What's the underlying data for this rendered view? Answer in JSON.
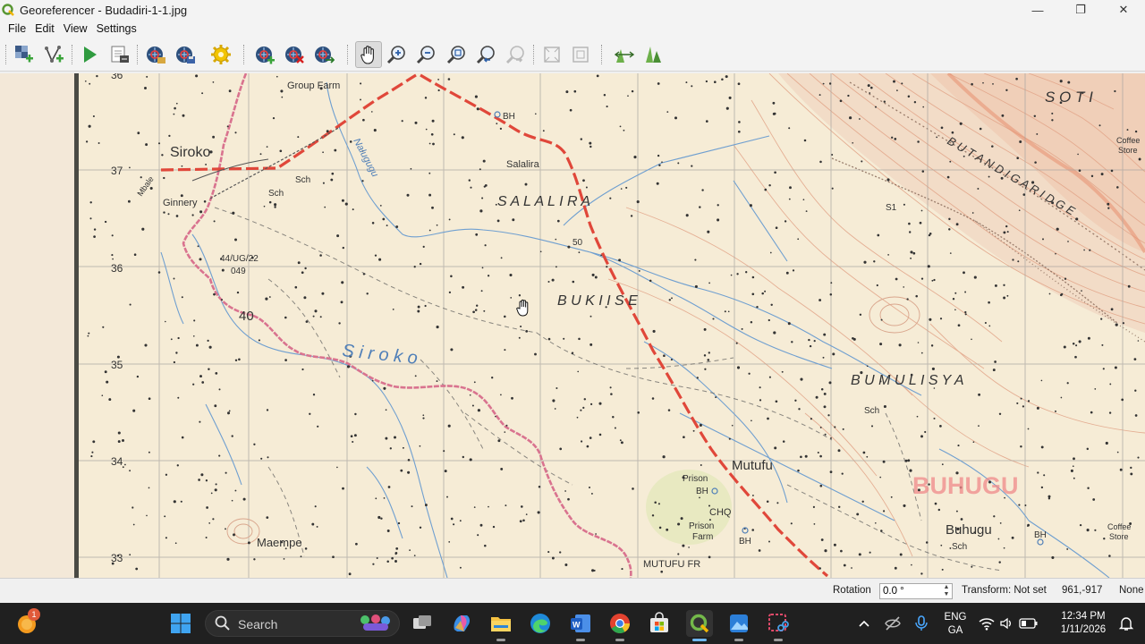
{
  "window": {
    "title": "Georeferencer - Budadiri-1-1.jpg",
    "controls": [
      "—",
      "❐",
      "✕"
    ]
  },
  "menu": [
    "File",
    "Edit",
    "View",
    "Settings"
  ],
  "toolbar": {
    "icons": [
      "add-raster-icon",
      "add-vector-icon",
      "start-georeferencing-icon",
      "generate-gdal-script-icon",
      "load-gcp-points-icon",
      "save-gcp-points-icon",
      "transformation-settings-icon",
      "add-point-icon",
      "delete-point-icon",
      "move-gcp-point-icon",
      "pan-icon",
      "zoom-in-icon",
      "zoom-out-icon",
      "zoom-to-layer-icon",
      "zoom-last-icon",
      "zoom-next-icon",
      "link-georeferencer-to-qgis-icon",
      "link-qgis-to-georeferencer-icon",
      "full-histogram-stretch-icon",
      "local-histogram-stretch-icon"
    ]
  },
  "map": {
    "grid_labels": [
      "36",
      "37",
      "36",
      "35",
      "34",
      "33"
    ],
    "places": {
      "group_farm": "Group Farm",
      "siroko": "Siroko",
      "ginnery": "Ginnery",
      "sch1": "Sch",
      "sch2": "Sch",
      "nalugugu": "Nalugugu",
      "bh1": "BH",
      "salalira": "Salalira",
      "salalira_area": "S A L A L I R A",
      "val50": "50",
      "trig": "44/UG/22",
      "trig2": "049",
      "val40": "40",
      "bukiise": "B U K I I S E",
      "siroko_river": "S i r o k o",
      "soti": "S O T I",
      "coffee_store1": "Coffee",
      "coffee_store1b": "Store",
      "butandiga": "B U T A N D I G A   R I D G E",
      "s1": "S1",
      "bumulisya": "B U M U L I S Y A",
      "sch3": "Sch",
      "buhugu_big": "BUHUGU",
      "mutufu": "Mutufu",
      "prison": "Prison",
      "bh2": "BH",
      "chq": "CHQ",
      "prison_farm1": "Prison",
      "prison_farm2": "Farm",
      "bh3": "BH",
      "mutufu_fr": "MUTUFU   FR",
      "maempe": "Maempe",
      "buhugu": "Buhugu",
      "sch4": "Sch",
      "bh4": "BH",
      "coffee_store2": "Coffee",
      "coffee_store2b": "Store",
      "mbale": "Mbale"
    }
  },
  "status": {
    "rotation_label": "Rotation",
    "rotation_value": "0.0 °",
    "transform": "Transform: Not set",
    "coords": "961,-917",
    "crs": "None"
  },
  "taskbar": {
    "search_label": "Search",
    "notification_count": "1",
    "lang_line1": "ENG",
    "lang_line2": "GA",
    "time": "12:34 PM",
    "date": "1/11/2026"
  },
  "colors": {
    "map_background": "#f6ecd6",
    "boundary_pink": "#d9738f",
    "railway_red": "#e0473a",
    "river_blue": "#6f9fd0",
    "relief_orange": "#e6a58a",
    "taskbar": "#202020"
  }
}
